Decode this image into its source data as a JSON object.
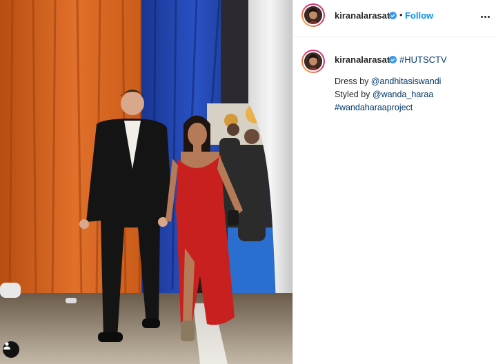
{
  "post": {
    "username": "kiranalarasati",
    "verified": true,
    "separator": "•",
    "follow_label": "Follow",
    "caption": {
      "hashtag_main": "#HUTSCTV",
      "dress_prefix": "Dress by ",
      "dress_handle": "@andhitasiswandi",
      "styled_prefix": "Styled by ",
      "styled_handle": "@wanda_haraa",
      "hashtag_project": "#wandaharaaproject"
    }
  },
  "icons": {
    "verified": "verified-badge-icon",
    "more": "more-options-icon",
    "tag": "user-tag-icon"
  },
  "colors": {
    "link": "#00376b",
    "follow": "#0095f6",
    "verified": "#3897f0",
    "text": "#262626",
    "curtain_orange": "#d8661e",
    "curtain_blue": "#1e3fa8",
    "dress_red": "#c8201e"
  }
}
